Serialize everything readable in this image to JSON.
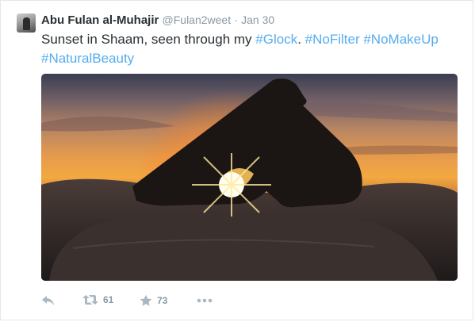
{
  "tweet": {
    "fullname": "Abu Fulan al-Muhajir",
    "username": "@Fulan2weet",
    "separator": "·",
    "time": "Jan 30",
    "text_plain": "Sunset in Shaam, seen through my ",
    "hashtag_glock": "#Glock",
    "hashtag_nofilter": "#NoFilter",
    "hashtag_nomakeup": "#NoMakeUp",
    "hashtag_naturalbeauty": "#NaturalBeauty",
    "photo_description": "handgun silhouetted against a sunset over sandbags"
  },
  "actions": {
    "reply_icon": "reply-icon",
    "retweet_icon": "retweet-icon",
    "retweet_count": "61",
    "favorite_icon": "star-icon",
    "favorite_count": "73",
    "more_icon": "more-dots-icon"
  },
  "colors": {
    "link": "#55acee",
    "muted": "#8899a6",
    "text": "#292f33"
  }
}
